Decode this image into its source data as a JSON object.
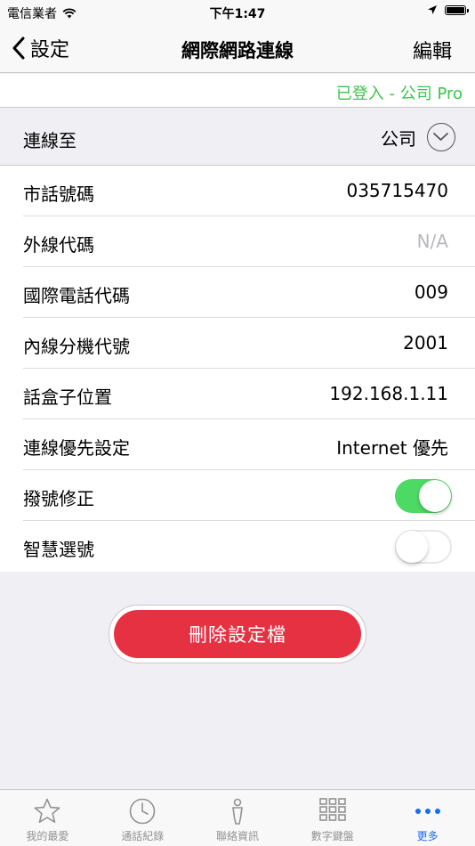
{
  "status_bar": {
    "carrier": "電信業者",
    "time": "下午1:47"
  },
  "nav": {
    "back_label": "設定",
    "title": "網際網路連線",
    "edit_label": "編輯"
  },
  "login_status": "已登入 - 公司 Pro",
  "connect_to": {
    "label": "連線至",
    "value": "公司"
  },
  "settings": [
    {
      "label": "市話號碼",
      "value": "035715470"
    },
    {
      "label": "外線代碼",
      "value": "N/A"
    },
    {
      "label": "國際電話代碼",
      "value": "009"
    },
    {
      "label": "內線分機代號",
      "value": "2001"
    },
    {
      "label": "話盒子位置",
      "value": "192.168.1.11"
    },
    {
      "label": "連線優先設定",
      "value": "Internet 優先"
    }
  ],
  "toggles": [
    {
      "label": "撥號修正",
      "on": true
    },
    {
      "label": "智慧選號",
      "on": false
    }
  ],
  "delete_button": "刪除設定檔",
  "tabs": [
    {
      "label": "我的最愛",
      "icon": "star-icon"
    },
    {
      "label": "通話紀錄",
      "icon": "clock-icon"
    },
    {
      "label": "聯絡資訊",
      "icon": "person-icon"
    },
    {
      "label": "數字鍵盤",
      "icon": "keypad-icon"
    },
    {
      "label": "更多",
      "icon": "more-icon",
      "active": true
    }
  ],
  "colors": {
    "accent": "#1a6cf0",
    "logged_in": "#3cc44a",
    "toggle_on": "#4cd964",
    "delete": "#e63142"
  }
}
